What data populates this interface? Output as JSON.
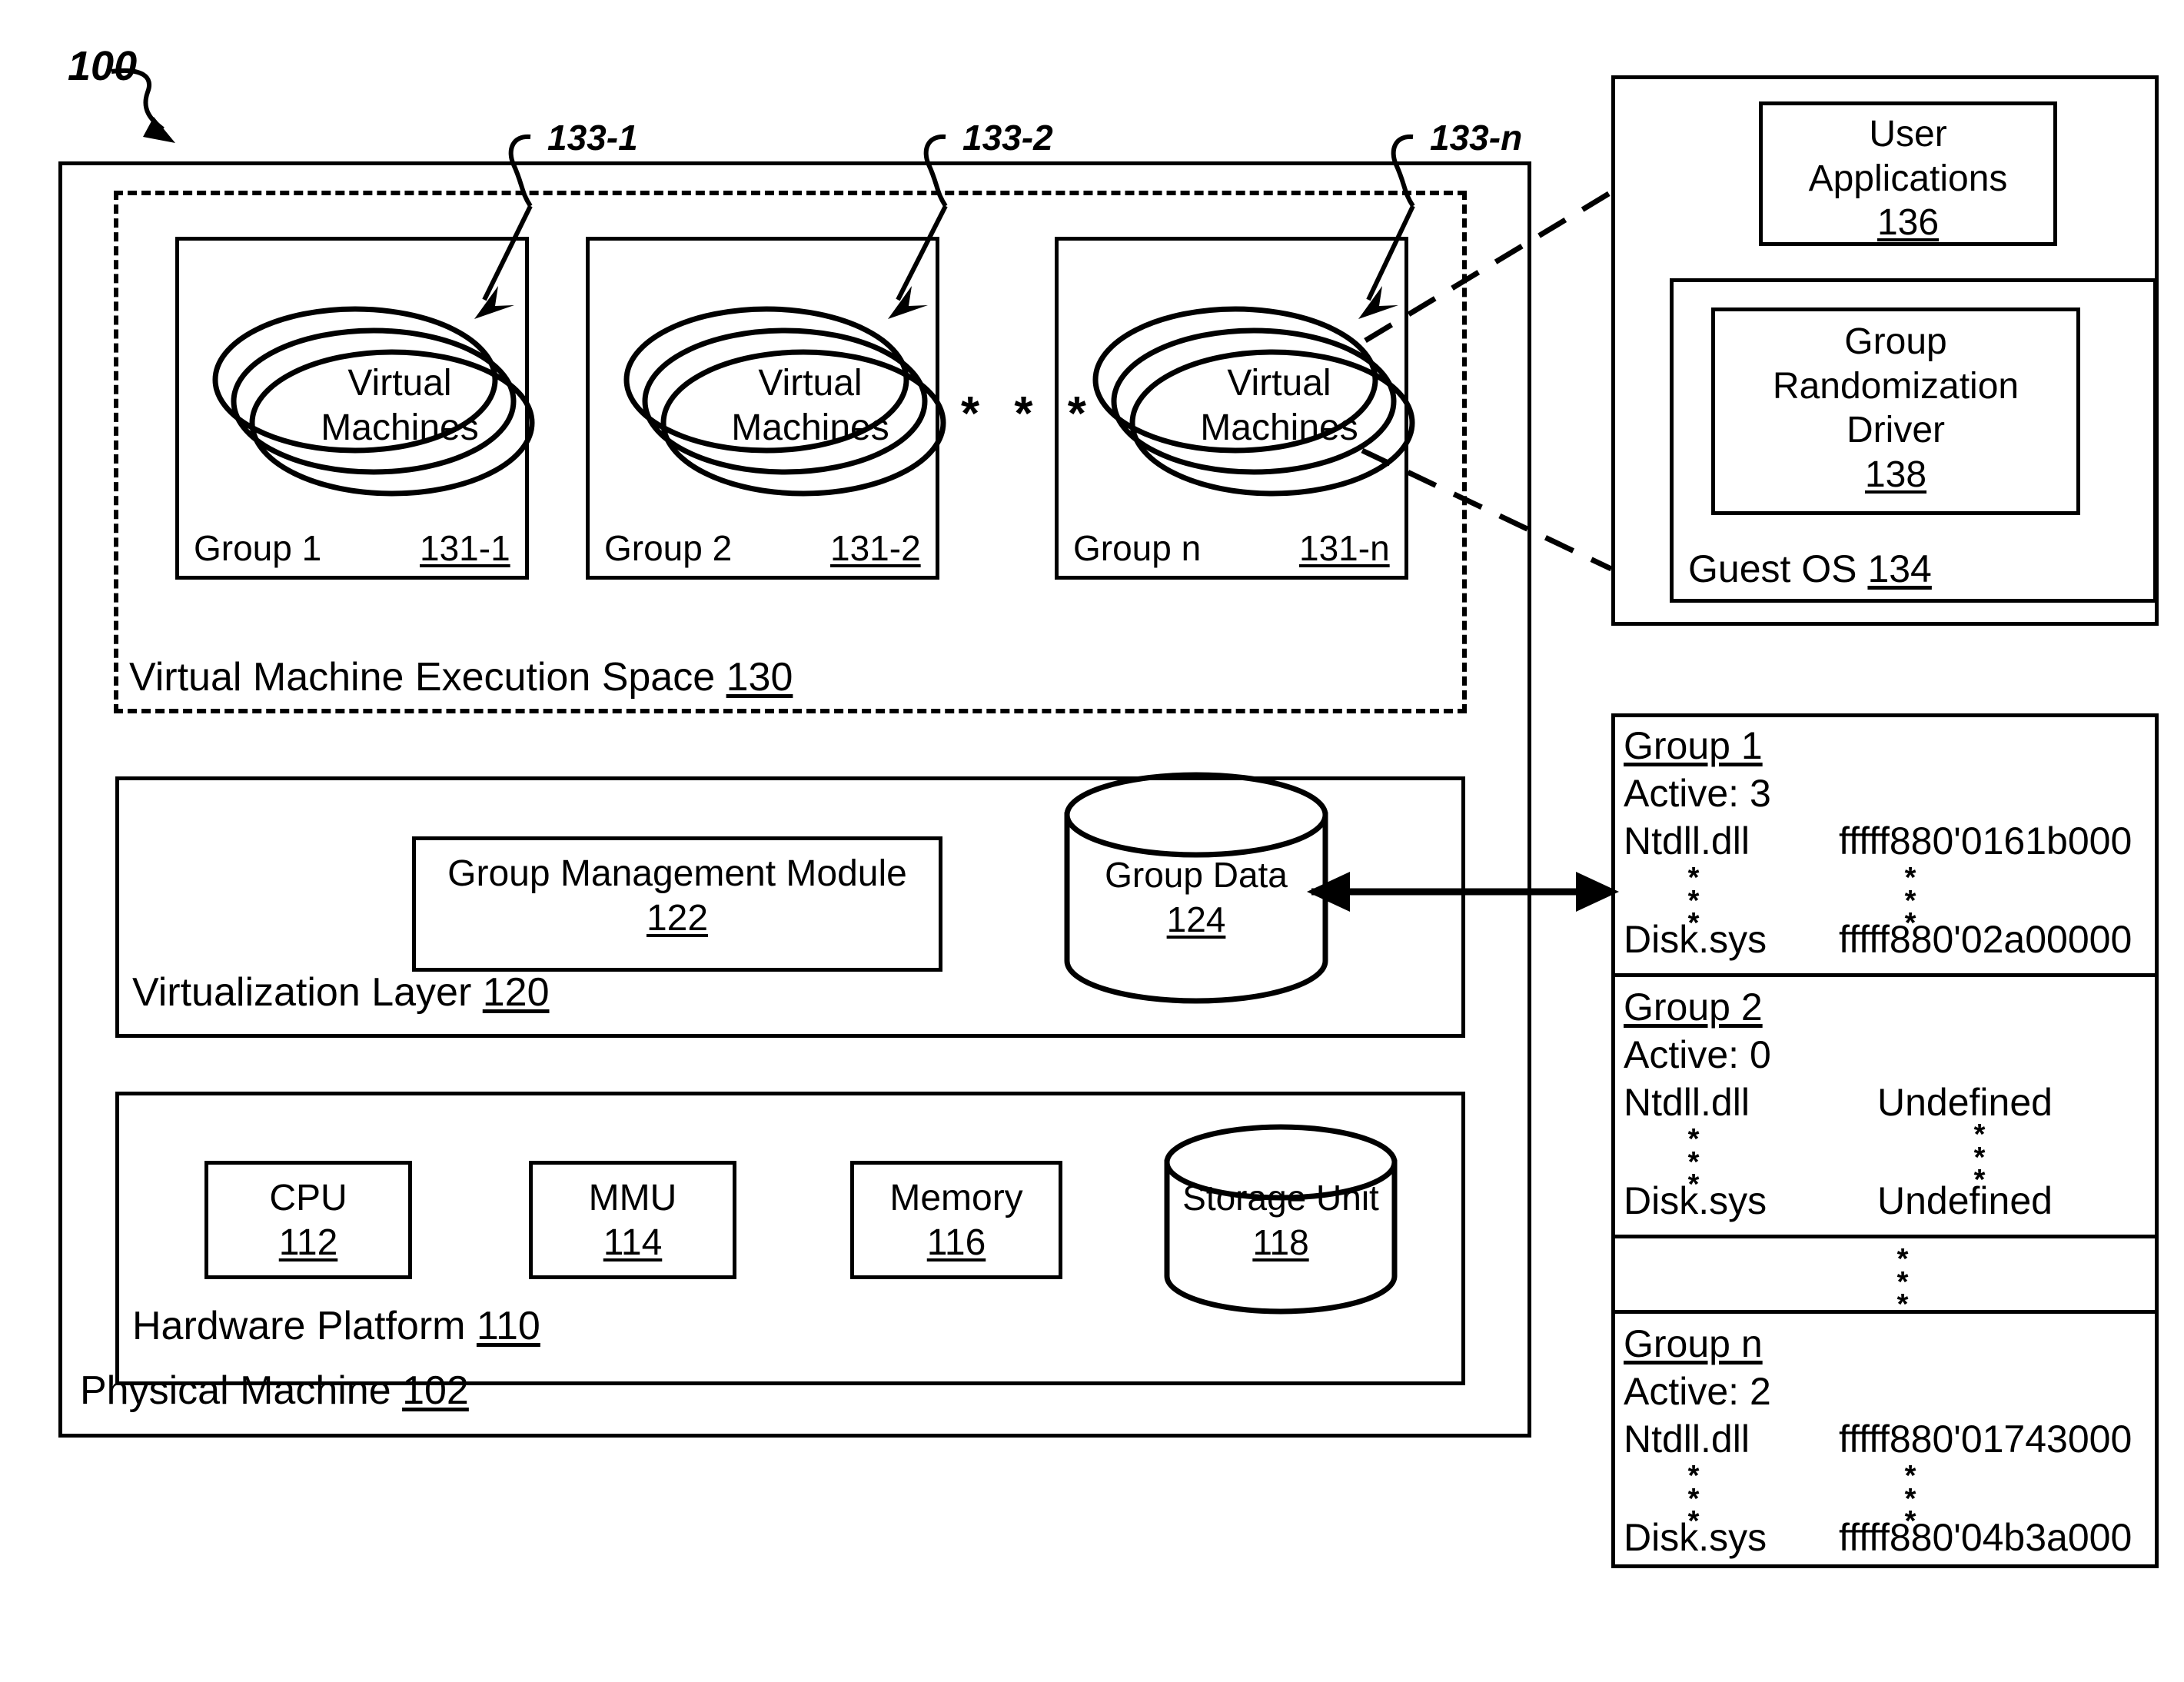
{
  "figure": {
    "number": "100",
    "callouts": [
      {
        "id": "133-1",
        "label": "133-1"
      },
      {
        "id": "133-2",
        "label": "133-2"
      },
      {
        "id": "133-n",
        "label": "133-n"
      }
    ]
  },
  "physical_machine": {
    "label": "Physical Machine",
    "ref": "102"
  },
  "vm_execution_space": {
    "label": "Virtual Machine Execution Space",
    "ref": "130",
    "ellipsis": "* * *",
    "groups": [
      {
        "name": "Group 1",
        "ref": "131-1",
        "vm_label_line1": "Virtual",
        "vm_label_line2": "Machines"
      },
      {
        "name": "Group 2",
        "ref": "131-2",
        "vm_label_line1": "Virtual",
        "vm_label_line2": "Machines"
      },
      {
        "name": "Group n",
        "ref": "131-n",
        "vm_label_line1": "Virtual",
        "vm_label_line2": "Machines"
      }
    ]
  },
  "virtualization_layer": {
    "label": "Virtualization Layer",
    "ref": "120",
    "module": {
      "label": "Group Management Module",
      "ref": "122"
    },
    "datastore": {
      "label": "Group Data",
      "ref": "124"
    }
  },
  "hardware_platform": {
    "label": "Hardware Platform",
    "ref": "110",
    "components": [
      {
        "label": "CPU",
        "ref": "112"
      },
      {
        "label": "MMU",
        "ref": "114"
      },
      {
        "label": "Memory",
        "ref": "116"
      }
    ],
    "storage": {
      "label": "Storage Unit",
      "ref": "118"
    }
  },
  "guest_os_detail": {
    "user_applications": {
      "line1": "User",
      "line2": "Applications",
      "ref": "136"
    },
    "driver": {
      "line1": "Group",
      "line2": "Randomization",
      "line3": "Driver",
      "ref": "138"
    },
    "guest_os": {
      "label": "Guest OS",
      "ref": "134"
    }
  },
  "group_data_table": {
    "sections": [
      {
        "title": "Group 1",
        "active_label": "Active: 3",
        "rows": [
          {
            "name": "Ntdll.dll",
            "value": "fffff880'0161b000"
          },
          {
            "name": "*\n*\n*",
            "value": "*\n*\n*",
            "is_ellipsis": true
          },
          {
            "name": "Disk.sys",
            "value": "fffff880'02a00000"
          }
        ]
      },
      {
        "title": "Group 2",
        "active_label": "Active: 0",
        "rows": [
          {
            "name": "Ntdll.dll",
            "value": "Undefined"
          },
          {
            "name": "*\n*\n*",
            "value": "*\n*\n*",
            "is_ellipsis": true
          },
          {
            "name": "Disk.sys",
            "value": "Undefined"
          }
        ]
      },
      {
        "title": "",
        "active_label": "",
        "is_gap": true,
        "gap_marker": "*\n*\n*"
      },
      {
        "title": "Group n",
        "active_label": "Active: 2",
        "rows": [
          {
            "name": "Ntdll.dll",
            "value": "fffff880'01743000"
          },
          {
            "name": "*\n*\n*",
            "value": "*\n*\n*",
            "is_ellipsis": true
          },
          {
            "name": "Disk.sys",
            "value": "fffff880'04b3a000"
          }
        ]
      }
    ]
  },
  "colors": {
    "stroke": "#000000",
    "background": "#ffffff"
  }
}
